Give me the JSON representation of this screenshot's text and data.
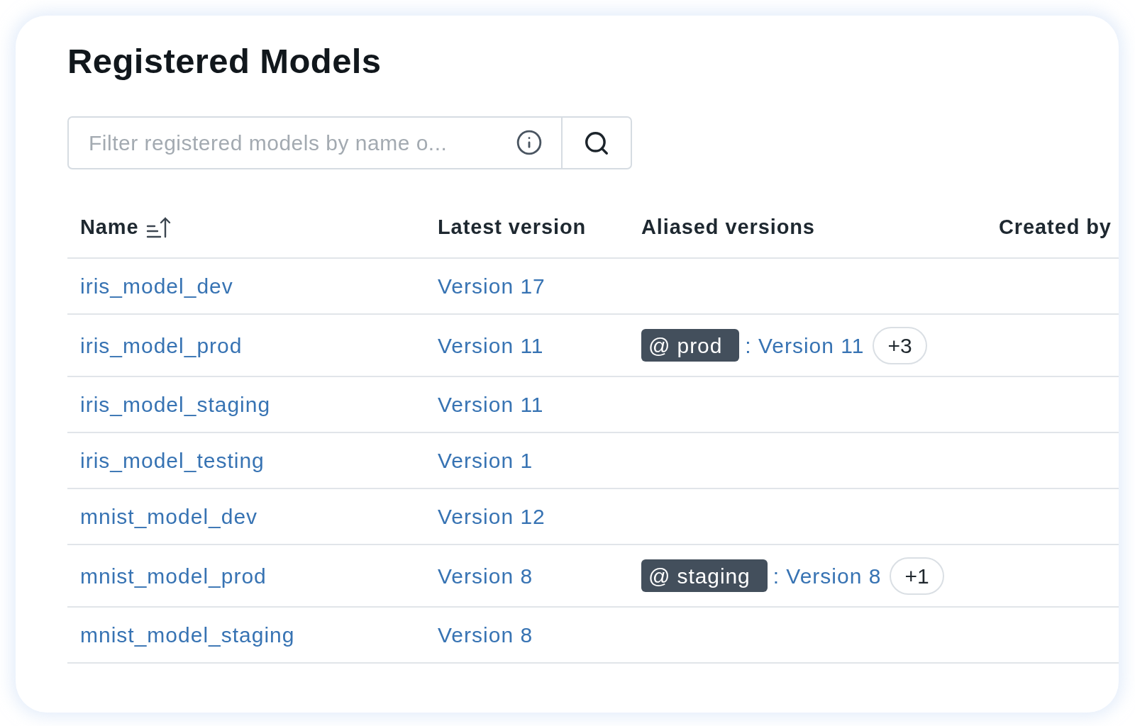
{
  "title": "Registered Models",
  "search": {
    "placeholder": "Filter registered models by name o..."
  },
  "table": {
    "columns": [
      {
        "label": "Name",
        "sorted": true,
        "ascending": true
      },
      {
        "label": "Latest version"
      },
      {
        "label": "Aliased versions"
      },
      {
        "label": "Created by"
      }
    ],
    "rows": [
      {
        "name": "iris_model_dev",
        "latest_version": "Version 17"
      },
      {
        "name": "iris_model_prod",
        "latest_version": "Version 11",
        "alias": {
          "tag": "@ prod",
          "version": ": Version 11",
          "more": "+3"
        }
      },
      {
        "name": "iris_model_staging",
        "latest_version": "Version 11"
      },
      {
        "name": "iris_model_testing",
        "latest_version": "Version 1"
      },
      {
        "name": "mnist_model_dev",
        "latest_version": "Version 12"
      },
      {
        "name": "mnist_model_prod",
        "latest_version": "Version 8",
        "alias": {
          "tag": "@ staging",
          "version": ": Version 8",
          "more": "+1"
        }
      },
      {
        "name": "mnist_model_staging",
        "latest_version": "Version 8"
      }
    ]
  }
}
